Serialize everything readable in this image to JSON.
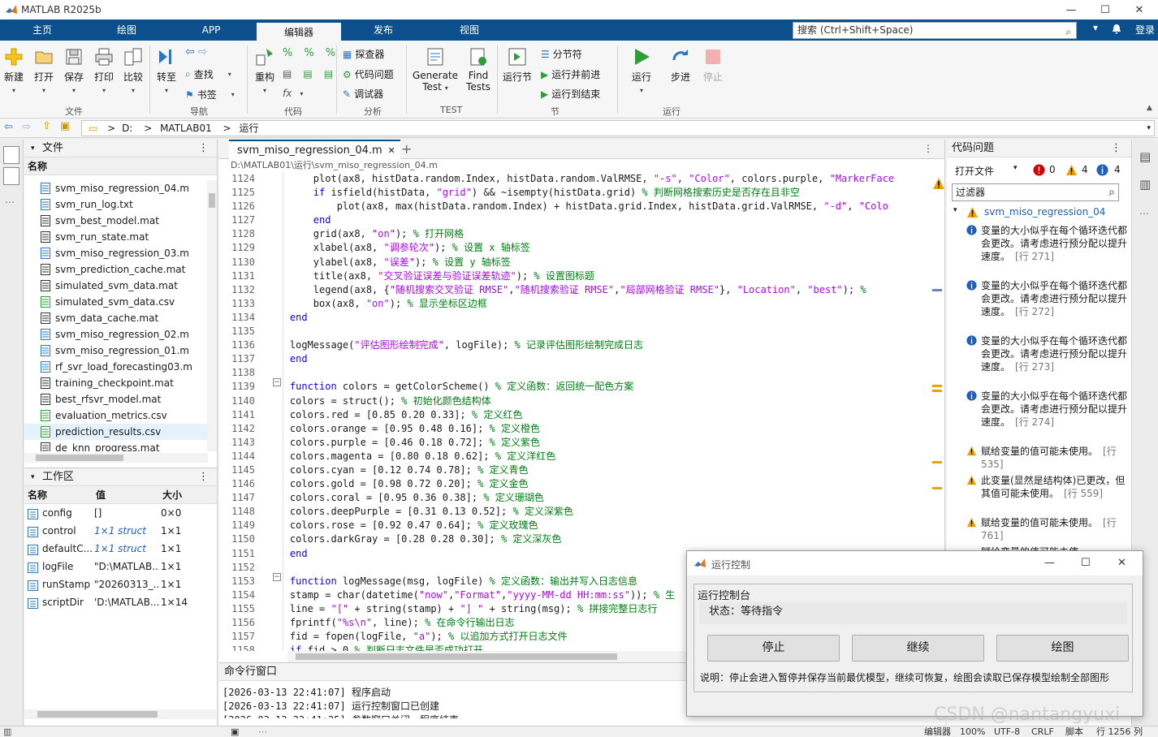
{
  "app": {
    "title": "MATLAB R2025b"
  },
  "window_controls": {
    "minimize": "—",
    "maximize": "☐",
    "close": "✕"
  },
  "ribbon": {
    "tabs": [
      "主页",
      "绘图",
      "APP",
      "编辑器",
      "发布",
      "视图"
    ],
    "active_tab": "编辑器",
    "search_placeholder": "搜索 (Ctrl+Shift+Space)",
    "login": "登录"
  },
  "toolstrip": {
    "file": {
      "new": "新建",
      "open": "打开",
      "save": "保存",
      "print": "打印",
      "compare": "比较",
      "group": "文件"
    },
    "navigate": {
      "goto": "转至",
      "find": "查找",
      "bookmark": "书签",
      "group": "导航"
    },
    "code": {
      "refactor": "重构",
      "group": "代码"
    },
    "analyze": {
      "profiler": "探查器",
      "code_issues": "代码问题",
      "debugger": "调试器",
      "group": "分析"
    },
    "test": {
      "generate_line1": "Generate",
      "generate_line2": "Test",
      "find_line1": "Find",
      "find_line2": "Tests",
      "group": "TEST"
    },
    "section": {
      "run_section": "运行节",
      "section_break": "分节符",
      "run_and_advance": "运行并前进",
      "run_to_end": "运行到结束",
      "group": "节"
    },
    "run": {
      "run": "运行",
      "step": "步进",
      "stop": "停止",
      "group": "运行"
    }
  },
  "address": {
    "drive": "D:",
    "folder1": "MATLAB01",
    "folder2": "运行",
    "sep": ">"
  },
  "files_panel": {
    "title": "文件",
    "column": "名称",
    "items": [
      "svm_miso_regression_04.m",
      "svm_run_log.txt",
      "svm_best_model.mat",
      "svm_run_state.mat",
      "svm_miso_regression_03.m",
      "svm_prediction_cache.mat",
      "simulated_svm_data.mat",
      "simulated_svm_data.csv",
      "svm_data_cache.mat",
      "svm_miso_regression_02.m",
      "svm_miso_regression_01.m",
      "rf_svr_load_forecasting03.m",
      "training_checkpoint.mat",
      "best_rfsvr_model.mat",
      "evaluation_metrics.csv",
      "prediction_results.csv",
      "de_knn_progress.mat"
    ]
  },
  "workspace": {
    "title": "工作区",
    "columns": [
      "名称",
      "值",
      "大小"
    ],
    "rows": [
      {
        "name": "config",
        "value": "[]",
        "size": "0×0"
      },
      {
        "name": "control",
        "value": "1×1 struct",
        "size": "1×1"
      },
      {
        "name": "defaultC...",
        "value": "1×1 struct",
        "size": "1×1"
      },
      {
        "name": "logFile",
        "value": "\"D:\\MATLAB...",
        "size": "1×1"
      },
      {
        "name": "runStamp",
        "value": "\"20260313_...",
        "size": "1×1"
      },
      {
        "name": "scriptDir",
        "value": "'D:\\MATLAB...",
        "size": "1×14"
      }
    ]
  },
  "editor": {
    "tab": "svm_miso_regression_04.m",
    "path": "D:\\MATLAB01\\运行\\svm_miso_regression_04.m",
    "lines": [
      {
        "n": "1124",
        "t": "        plot(ax8, histData.random.Index, histData.random.ValRMSE, \"-s\", \"Color\", colors.purple, \"MarkerFace"
      },
      {
        "n": "1125",
        "t": "        if isfield(histData, \"grid\") && ~isempty(histData.grid) % 判断网格搜索历史是否存在且非空"
      },
      {
        "n": "1126",
        "t": "            plot(ax8, max(histData.random.Index) + histData.grid.Index, histData.grid.ValRMSE, \"-d\", \"Colo"
      },
      {
        "n": "1127",
        "t": "        end"
      },
      {
        "n": "1128",
        "t": "        grid(ax8, \"on\"); % 打开网格"
      },
      {
        "n": "1129",
        "t": "        xlabel(ax8, \"调参轮次\"); % 设置 x 轴标签"
      },
      {
        "n": "1130",
        "t": "        ylabel(ax8, \"误差\"); % 设置 y 轴标签"
      },
      {
        "n": "1131",
        "t": "        title(ax8, \"交叉验证误差与验证误差轨迹\"); % 设置图标题"
      },
      {
        "n": "1132",
        "t": "        legend(ax8, {\"随机搜索交叉验证 RMSE\",\"随机搜索验证 RMSE\",\"局部网格验证 RMSE\"}, \"Location\", \"best\"); %"
      },
      {
        "n": "1133",
        "t": "        box(ax8, \"on\"); % 显示坐标区边框"
      },
      {
        "n": "1134",
        "t": "    end"
      },
      {
        "n": "1135",
        "t": ""
      },
      {
        "n": "1136",
        "t": "    logMessage(\"评估图形绘制完成\", logFile); % 记录评估图形绘制完成日志"
      },
      {
        "n": "1137",
        "t": "    end"
      },
      {
        "n": "1138",
        "t": ""
      },
      {
        "n": "1139",
        "t": "    function colors = getColorScheme() % 定义函数：返回统一配色方案"
      },
      {
        "n": "1140",
        "t": "    colors = struct(); % 初始化颜色结构体"
      },
      {
        "n": "1141",
        "t": "    colors.red = [0.85 0.20 0.33]; % 定义红色"
      },
      {
        "n": "1142",
        "t": "    colors.orange = [0.95 0.48 0.16]; % 定义橙色"
      },
      {
        "n": "1143",
        "t": "    colors.purple = [0.46 0.18 0.72]; % 定义紫色"
      },
      {
        "n": "1144",
        "t": "    colors.magenta = [0.80 0.18 0.62]; % 定义洋红色"
      },
      {
        "n": "1145",
        "t": "    colors.cyan = [0.12 0.74 0.78]; % 定义青色"
      },
      {
        "n": "1146",
        "t": "    colors.gold = [0.98 0.72 0.20]; % 定义金色"
      },
      {
        "n": "1147",
        "t": "    colors.coral = [0.95 0.36 0.38]; % 定义珊瑚色"
      },
      {
        "n": "1148",
        "t": "    colors.deepPurple = [0.31 0.13 0.52]; % 定义深紫色"
      },
      {
        "n": "1149",
        "t": "    colors.rose = [0.92 0.47 0.64]; % 定义玫瑰色"
      },
      {
        "n": "1150",
        "t": "    colors.darkGray = [0.28 0.28 0.30]; % 定义深灰色"
      },
      {
        "n": "1151",
        "t": "    end"
      },
      {
        "n": "1152",
        "t": ""
      },
      {
        "n": "1153",
        "t": "    function logMessage(msg, logFile) % 定义函数：输出并写入日志信息"
      },
      {
        "n": "1154",
        "t": "    stamp = char(datetime(\"now\",\"Format\",\"yyyy-MM-dd HH:mm:ss\")); % 生"
      },
      {
        "n": "1155",
        "t": "    line = \"[\" + string(stamp) + \"] \" + string(msg); % 拼接完整日志行"
      },
      {
        "n": "1156",
        "t": "    fprintf(\"%s\\n\", line); % 在命令行输出日志"
      },
      {
        "n": "1157",
        "t": "    fid = fopen(logFile, \"a\"); % 以追加方式打开日志文件"
      },
      {
        "n": "1158",
        "t": "    if fid > 0 % 判断日志文件是否成功打开"
      }
    ]
  },
  "command_window": {
    "title": "命令行窗口",
    "lines": [
      "[2026-03-13 22:41:07] 程序启动",
      "[2026-03-13 22:41:07] 运行控制窗口已创建",
      "[2026-03-13 22:41:25] 参数窗口关闭，程序结束"
    ]
  },
  "code_issues": {
    "title": "代码问题",
    "scope": "打开文件",
    "errors": "0",
    "warnings": "4",
    "infos": "4",
    "filter_placeholder": "过滤器",
    "file": "svm_miso_regression_04.m",
    "items": [
      {
        "kind": "info",
        "text": "变量的大小似乎在每个循环迭代都会更改。请考虑进行预分配以提升速度。",
        "ref": "[行 271]"
      },
      {
        "kind": "info",
        "text": "变量的大小似乎在每个循环迭代都会更改。请考虑进行预分配以提升速度。",
        "ref": "[行 272]"
      },
      {
        "kind": "info",
        "text": "变量的大小似乎在每个循环迭代都会更改。请考虑进行预分配以提升速度。",
        "ref": "[行 273]"
      },
      {
        "kind": "info",
        "text": "变量的大小似乎在每个循环迭代都会更改。请考虑进行预分配以提升速度。",
        "ref": "[行 274]"
      },
      {
        "kind": "warn",
        "text": "赋给变量的值可能未使用。",
        "ref": "[行 535]"
      },
      {
        "kind": "warn",
        "text": "此变量(显然是结构体)已更改，但其值可能未使用。",
        "ref": "[行 559]"
      },
      {
        "kind": "warn",
        "text": "赋给变量的值可能未使用。",
        "ref": "[行 761]"
      },
      {
        "kind": "warn",
        "text": "赋给变量的值可能未使",
        "ref": ""
      }
    ]
  },
  "statusbar": {
    "encoding_label": "编辑器",
    "zoom": "100%",
    "encoding": "UTF-8",
    "eol": "CRLF",
    "type": "脚本",
    "position": "行 1256 列"
  },
  "dialog": {
    "title": "运行控制",
    "panel_title": "运行控制台",
    "status": "状态：等待指令",
    "buttons": {
      "stop": "停止",
      "continue": "继续",
      "plot": "绘图"
    },
    "note": "说明：停止会进入暂停并保存当前最优模型，继续可恢复，绘图会读取已保存模型绘制全部图形"
  },
  "watermark": "CSDN @nantangyuxi",
  "colors": {
    "ribbon": "#0b4f8c",
    "keyword": "#0e00ff",
    "string": "#a709f5",
    "comment": "#008013",
    "warning": "#f0a000",
    "error": "#d20000",
    "info": "#1f5fbf"
  }
}
